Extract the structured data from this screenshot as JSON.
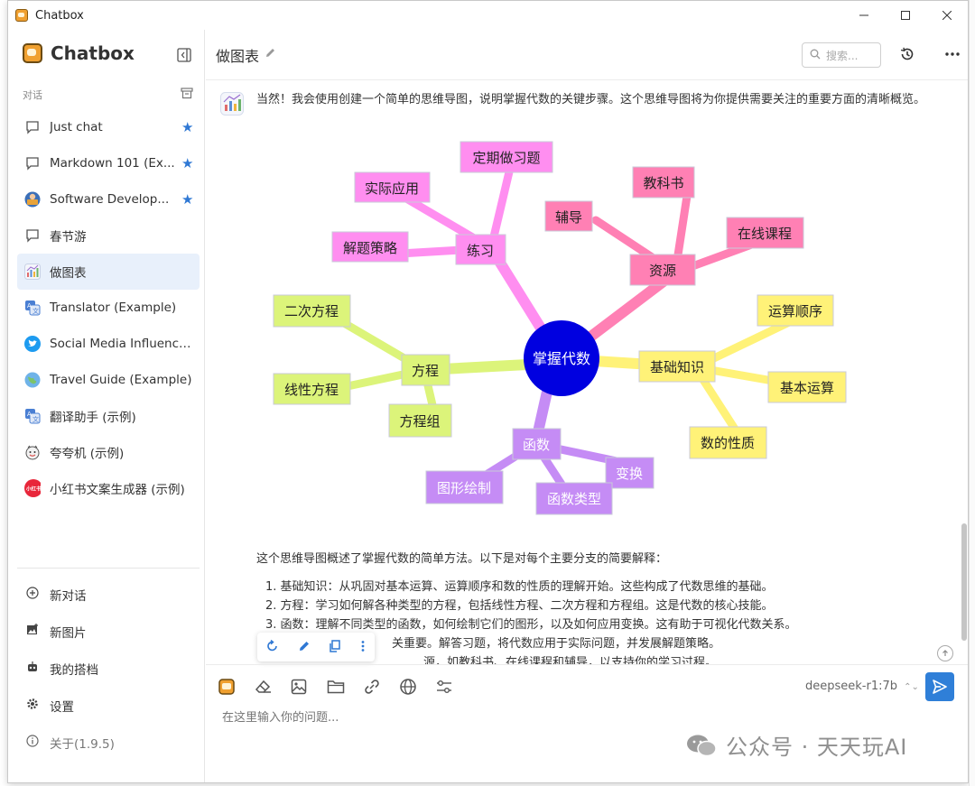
{
  "window": {
    "title": "Chatbox"
  },
  "sidebar": {
    "brand": "Chatbox",
    "section_label": "对话",
    "conversations": [
      {
        "label": "Just chat",
        "starred": true,
        "icon": "chat-bubble-icon"
      },
      {
        "label": "Markdown 101 (Ex...",
        "starred": true,
        "icon": "chat-bubble-icon"
      },
      {
        "label": "Software Develop...",
        "starred": true,
        "icon": "developer-avatar-icon"
      },
      {
        "label": "春节游",
        "starred": false,
        "icon": "chat-bubble-icon"
      },
      {
        "label": "做图表",
        "starred": false,
        "icon": "chart-icon",
        "active": true
      },
      {
        "label": "Translator (Example)",
        "starred": false,
        "icon": "translator-icon"
      },
      {
        "label": "Social Media Influencer ...",
        "starred": false,
        "icon": "twitter-icon"
      },
      {
        "label": "Travel Guide (Example)",
        "starred": false,
        "icon": "globe-icon"
      },
      {
        "label": "翻译助手 (示例)",
        "starred": false,
        "icon": "translator-icon"
      },
      {
        "label": "夸夸机 (示例)",
        "starred": false,
        "icon": "praise-icon"
      },
      {
        "label": "小红书文案生成器 (示例)",
        "starred": false,
        "icon": "xiaohongshu-icon"
      }
    ],
    "bottom": {
      "new_chat": "新对话",
      "new_image": "新图片",
      "my_copilots": "我的搭档",
      "settings": "设置",
      "about": "关于(1.9.5)"
    }
  },
  "header": {
    "title": "做图表",
    "search_placeholder": "搜索..."
  },
  "message": {
    "intro": "当然！我会使用创建一个简单的思维导图，说明掌握代数的关键步骤。这个思维导图将为你提供需要关注的重要方面的清晰概览。",
    "mindmap": {
      "center": "掌握代数",
      "branches": [
        {
          "label": "练习",
          "color": "#ff8ef0",
          "children": [
            "实际应用",
            "定期做习题",
            "解题策略"
          ]
        },
        {
          "label": "资源",
          "color": "#ff80b4",
          "children": [
            "辅导",
            "教科书",
            "在线课程"
          ]
        },
        {
          "label": "基础知识",
          "color": "#fff278",
          "children": [
            "运算顺序",
            "基本运算",
            "数的性质"
          ]
        },
        {
          "label": "方程",
          "color": "#dcf47a",
          "children": [
            "二次方程",
            "线性方程",
            "方程组"
          ]
        },
        {
          "label": "函数",
          "color": "#c58cf5",
          "children": [
            "变换",
            "图形绘制",
            "函数类型"
          ]
        }
      ]
    },
    "summary": "这个思维导图概述了掌握代数的简单方法。以下是对每个主要分支的简要解释：",
    "points": [
      "1. 基础知识：从巩固对基本运算、运算顺序和数的性质的理解开始。这些构成了代数思维的基础。",
      "2. 方程：学习如何解各种类型的方程，包括线性方程、二次方程和方程组。这是代数的核心技能。",
      "3. 函数：理解不同类型的函数，如何绘制它们的图形，以及如何应用变换。这有助于可视化代数关系。",
      "关重要。解答习题，将代数应用于实际问题，并发展解题策略。",
      "源，如教科书、在线课程和辅导，以支持你的学习过程。"
    ]
  },
  "composer": {
    "model": "deepseek-r1:7b",
    "placeholder": "在这里输入你的问题..."
  },
  "watermark": "公众号 · 天天玩AI"
}
